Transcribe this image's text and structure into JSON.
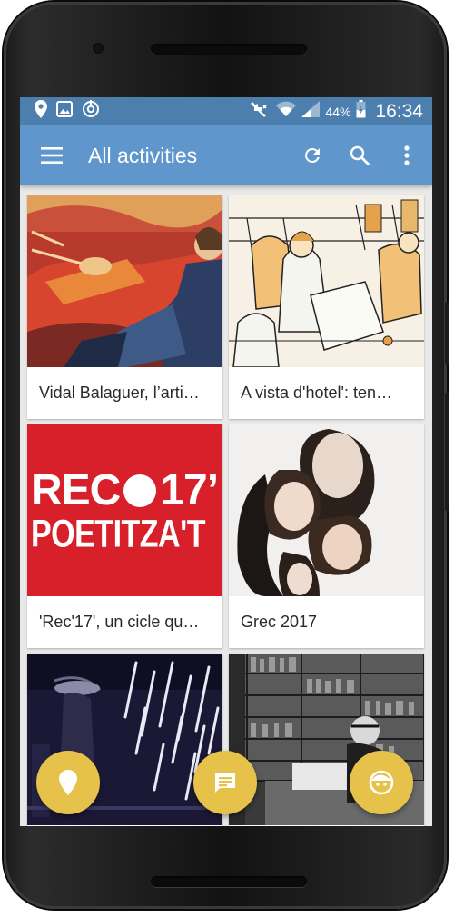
{
  "status_bar": {
    "battery": "44%",
    "time": "16:34",
    "left_icons": [
      "location-icon",
      "image-icon",
      "sync-icon"
    ],
    "right_icons": [
      "mute-icon",
      "wifi-icon",
      "signal-icon",
      "battery-icon"
    ]
  },
  "app_bar": {
    "title": "All activities",
    "actions": [
      "refresh-icon",
      "search-icon",
      "more-vert-icon"
    ]
  },
  "activities": [
    {
      "title": "Vidal Balaguer, l’arti…"
    },
    {
      "title": "A vista d'hotel': ten…"
    },
    {
      "title": "'Rec'17', un cicle qu…",
      "image_text_line1": "REC",
      "image_text_line1b": "17’",
      "image_text_line2": "POETITZA'T"
    },
    {
      "title": "Grec 2017"
    },
    {
      "title": ""
    },
    {
      "title": ""
    }
  ],
  "fabs": [
    "map-marker-icon",
    "chat-icon",
    "face-icon"
  ],
  "colors": {
    "status_bar": "#4c7fae",
    "app_bar": "#5f97cc",
    "fab": "#e6c24a",
    "rec_red": "#d7202a"
  }
}
